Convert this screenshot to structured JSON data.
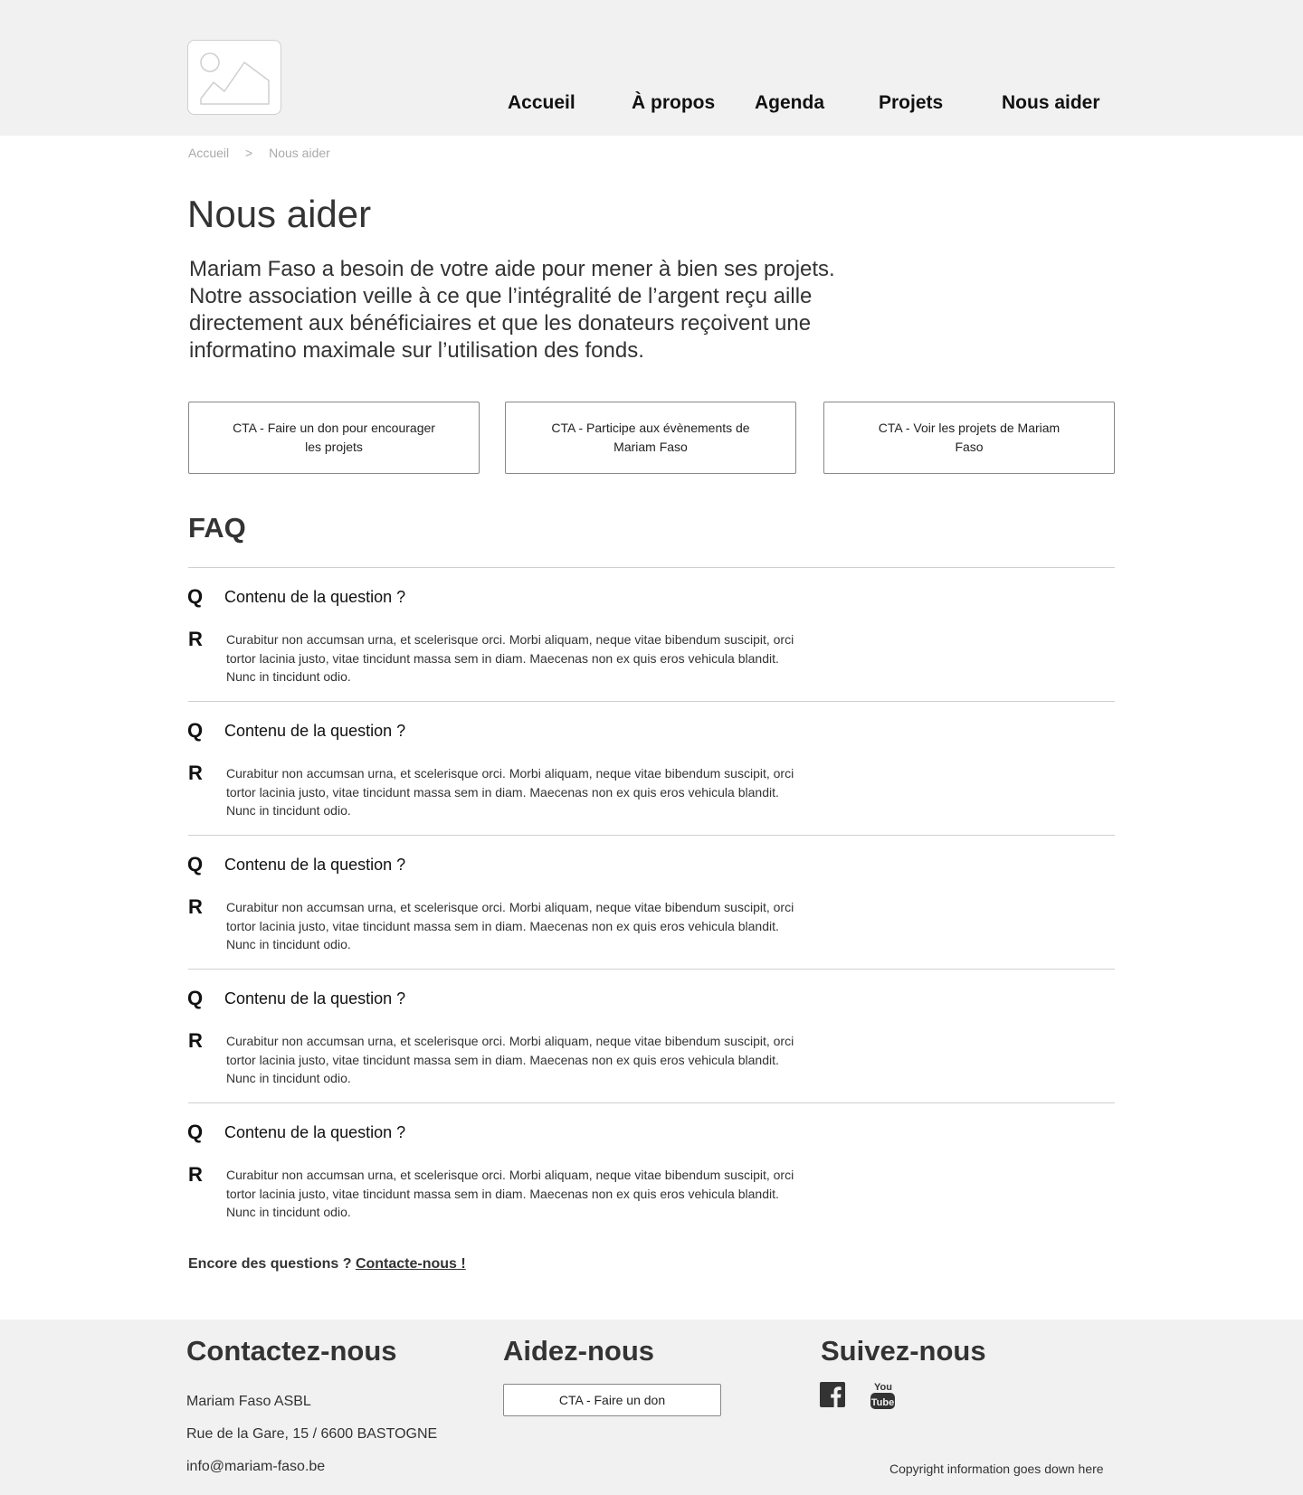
{
  "header": {
    "logo": "image-placeholder-icon",
    "nav": [
      {
        "label": "Accueil"
      },
      {
        "label": "À propos"
      },
      {
        "label": "Agenda"
      },
      {
        "label": "Projets"
      },
      {
        "label": "Nous aider"
      }
    ]
  },
  "breadcrumb": {
    "items": [
      "Accueil",
      "Nous aider"
    ],
    "separator": ">"
  },
  "main": {
    "title": "Nous aider",
    "intro": "Mariam Faso a besoin de votre aide pour mener à bien ses projets. Notre association veille à ce que l’intégralité de l’argent reçu aille directement aux bénéficiaires et que les donateurs reçoivent une informatino maximale sur l’utilisation des fonds.",
    "ctas": [
      {
        "label": "CTA - Faire un don pour encourager les projets"
      },
      {
        "label": "CTA - Participe aux évènements de Mariam Faso"
      },
      {
        "label": "CTA - Voir les projets de Mariam Faso"
      }
    ]
  },
  "faq": {
    "heading": "FAQ",
    "q_letter": "Q",
    "r_letter": "R",
    "items": [
      {
        "question": "Contenu de la question ?",
        "answer": "Curabitur non accumsan urna, et scelerisque orci. Morbi aliquam, neque vitae bibendum suscipit, orci tortor lacinia justo, vitae tincidunt massa sem in diam. Maecenas non ex quis eros vehicula blandit. Nunc in tincidunt odio."
      },
      {
        "question": "Contenu de la question ?",
        "answer": "Curabitur non accumsan urna, et scelerisque orci. Morbi aliquam, neque vitae bibendum suscipit, orci tortor lacinia justo, vitae tincidunt massa sem in diam. Maecenas non ex quis eros vehicula blandit. Nunc in tincidunt odio."
      },
      {
        "question": "Contenu de la question ?",
        "answer": "Curabitur non accumsan urna, et scelerisque orci. Morbi aliquam, neque vitae bibendum suscipit, orci tortor lacinia justo, vitae tincidunt massa sem in diam. Maecenas non ex quis eros vehicula blandit. Nunc in tincidunt odio."
      },
      {
        "question": "Contenu de la question ?",
        "answer": "Curabitur non accumsan urna, et scelerisque orci. Morbi aliquam, neque vitae bibendum suscipit, orci tortor lacinia justo, vitae tincidunt massa sem in diam. Maecenas non ex quis eros vehicula blandit. Nunc in tincidunt odio."
      },
      {
        "question": "Contenu de la question ?",
        "answer": "Curabitur non accumsan urna, et scelerisque orci. Morbi aliquam, neque vitae bibendum suscipit, orci tortor lacinia justo, vitae tincidunt massa sem in diam. Maecenas non ex quis eros vehicula blandit. Nunc in tincidunt odio."
      }
    ],
    "more_text": "Encore des questions ?",
    "more_link": "Contacte-nous !"
  },
  "footer": {
    "contact": {
      "heading": "Contactez-nous",
      "name": "Mariam Faso ASBL",
      "address": "Rue de la Gare, 15 / 6600 BASTOGNE",
      "email": "info@mariam-faso.be"
    },
    "help": {
      "heading": "Aidez-nous",
      "cta": "CTA - Faire un don"
    },
    "follow": {
      "heading": "Suivez-nous",
      "icons": [
        "facebook-icon",
        "youtube-icon"
      ]
    },
    "copyright": "Copyright information goes down here"
  },
  "colors": {
    "header_bg": "#f1f1f1",
    "footer_bg": "#f1f1f1",
    "text": "#333333",
    "divider": "#cfcfcf",
    "border": "#888888"
  }
}
